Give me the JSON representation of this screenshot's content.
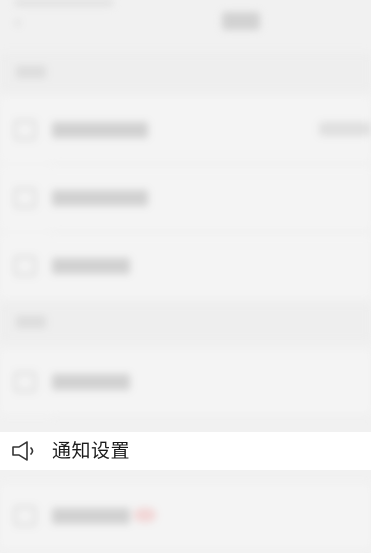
{
  "focused_item": {
    "label": "通知设置",
    "icon": "speaker-icon"
  },
  "blurred_rows": [
    {
      "icon": "settings-item-icon"
    },
    {
      "icon": "settings-item-icon"
    },
    {
      "icon": "settings-item-icon"
    },
    {
      "icon": "settings-item-icon"
    },
    {
      "icon": "settings-item-icon"
    }
  ]
}
